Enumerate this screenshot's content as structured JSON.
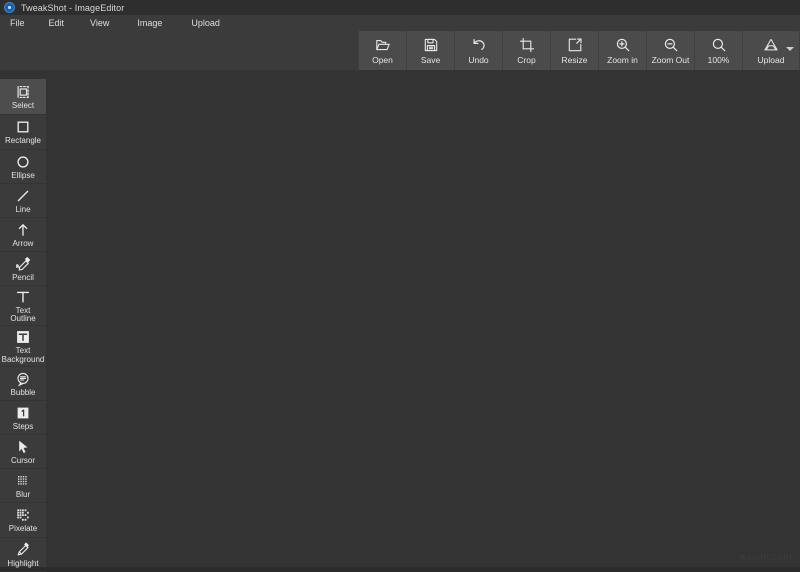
{
  "window": {
    "title": "TweakShot - ImageEditor",
    "app_icon": "tweakshot-logo-icon",
    "bg_color": "#333333",
    "chrome_color": "#3b3b3b",
    "toolbar_color": "#4b4b4b",
    "titlebar_color": "#2e2e2e"
  },
  "menubar": {
    "items": [
      {
        "label": "File",
        "name": "file"
      },
      {
        "label": "Edit",
        "name": "edit"
      },
      {
        "label": "View",
        "name": "view"
      },
      {
        "label": "Image",
        "name": "image"
      },
      {
        "label": "Upload",
        "name": "upload"
      }
    ]
  },
  "toolbar": {
    "buttons": [
      {
        "label": "Open",
        "icon": "folder-open-icon"
      },
      {
        "label": "Save",
        "icon": "floppy-disk-icon"
      },
      {
        "label": "Undo",
        "icon": "undo-arrow-icon"
      },
      {
        "label": "Crop",
        "icon": "crop-icon"
      },
      {
        "label": "Resize",
        "icon": "resize-arrow-box-icon"
      },
      {
        "label": "Zoom in",
        "icon": "magnifier-plus-icon"
      },
      {
        "label": "Zoom Out",
        "icon": "magnifier-minus-icon"
      },
      {
        "label": "100%",
        "icon": "magnifier-icon"
      },
      {
        "label": "Upload",
        "icon": "google-drive-icon"
      }
    ]
  },
  "sidebar": {
    "active_index": 0,
    "items": [
      {
        "label": "Select",
        "icon": "selection-marquee-icon"
      },
      {
        "label": "Rectangle",
        "icon": "square-outline-icon"
      },
      {
        "label": "Ellipse",
        "icon": "circle-outline-icon"
      },
      {
        "label": "Line",
        "icon": "diagonal-line-icon"
      },
      {
        "label": "Arrow",
        "icon": "arrow-up-icon"
      },
      {
        "label": "Pencil",
        "icon": "pencil-scribble-icon"
      },
      {
        "label": "Text\nOutline",
        "icon": "text-outline-t-icon"
      },
      {
        "label": "Text\nBackground",
        "icon": "text-background-t-icon"
      },
      {
        "label": "Bubble",
        "icon": "speech-bubble-icon"
      },
      {
        "label": "Steps",
        "icon": "numbered-step-icon"
      },
      {
        "label": "Cursor",
        "icon": "mouse-cursor-icon"
      },
      {
        "label": "Blur",
        "icon": "blur-grid-icon"
      },
      {
        "label": "Pixelate",
        "icon": "pixelate-grid-icon"
      },
      {
        "label": "Highlight",
        "icon": "highlighter-marker-icon"
      }
    ]
  },
  "canvas": {
    "watermark": "wsxdn.com"
  }
}
